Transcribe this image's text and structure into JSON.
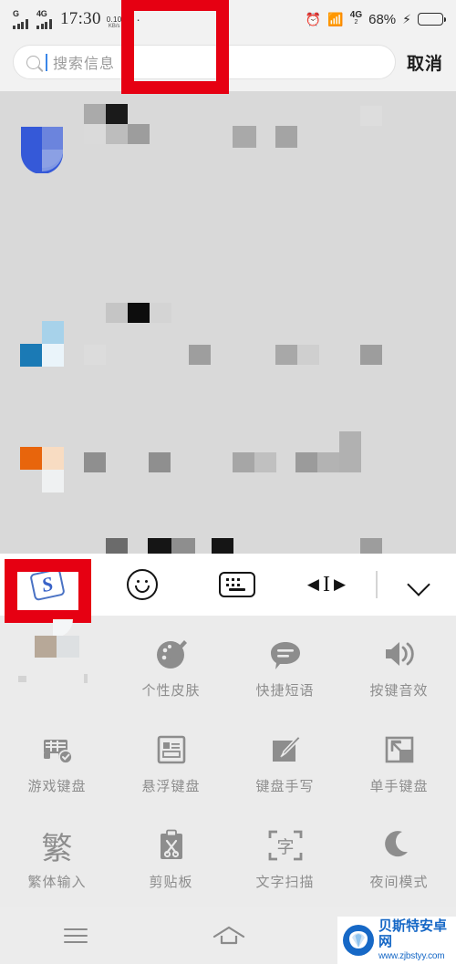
{
  "statusbar": {
    "carrier1_label": "G",
    "carrier2_label": "4G",
    "time": "17:30",
    "netspeed_value": "0.10",
    "netspeed_unit": "KB/s",
    "overflow_dots": "··",
    "alarm_icon": "alarm-clock-icon",
    "vibrate_icon": "vibrate-icon",
    "sim2_label": "4G",
    "sim2_sub": "2",
    "battery_percent": "68%",
    "charging_icon": "lightning-bolt-icon",
    "battery_fill_percent": 68
  },
  "search": {
    "placeholder": "搜索信息",
    "value": "",
    "icon": "search-icon",
    "cancel_label": "取消",
    "caret_color": "#3a86e8"
  },
  "keyboard_toolbar": {
    "items": [
      {
        "name": "sogou-logo-button",
        "label": "S",
        "icon": "sogou-logo-icon",
        "highlighted": true
      },
      {
        "name": "emoji-button",
        "label": "",
        "icon": "smiley-icon",
        "highlighted": false
      },
      {
        "name": "keyboard-layout-button",
        "label": "",
        "icon": "keyboard-icon",
        "highlighted": false
      },
      {
        "name": "cursor-move-button",
        "label": "",
        "icon": "cursor-move-icon",
        "highlighted": false
      },
      {
        "name": "collapse-keyboard-button",
        "label": "",
        "icon": "chevron-down-icon",
        "highlighted": false
      }
    ]
  },
  "panel": {
    "rows": [
      [
        {
          "label": "",
          "icon": "blurred-icon",
          "blurred": true,
          "highlighted": false
        },
        {
          "label": "个性皮肤",
          "icon": "palette-brush-icon",
          "blurred": false,
          "highlighted": true
        },
        {
          "label": "快捷短语",
          "icon": "chat-bubble-icon",
          "blurred": false,
          "highlighted": false
        },
        {
          "label": "按键音效",
          "icon": "speaker-icon",
          "blurred": false,
          "highlighted": false
        }
      ],
      [
        {
          "label": "游戏键盘",
          "icon": "gamepad-check-icon",
          "blurred": false,
          "highlighted": false
        },
        {
          "label": "悬浮键盘",
          "icon": "floating-keyboard-icon",
          "blurred": false,
          "highlighted": false
        },
        {
          "label": "键盘手写",
          "icon": "handwriting-pen-icon",
          "blurred": false,
          "highlighted": false
        },
        {
          "label": "单手键盘",
          "icon": "one-hand-keyboard-icon",
          "blurred": false,
          "highlighted": false
        }
      ],
      [
        {
          "label": "繁体输入",
          "icon": "traditional-chinese-icon",
          "glyph": "繁",
          "blurred": false,
          "highlighted": false
        },
        {
          "label": "剪贴板",
          "icon": "clipboard-scissors-icon",
          "blurred": false,
          "highlighted": false
        },
        {
          "label": "文字扫描",
          "icon": "text-scan-icon",
          "glyph": "字",
          "blurred": false,
          "highlighted": false
        },
        {
          "label": "夜间模式",
          "icon": "moon-icon",
          "blurred": false,
          "highlighted": false
        }
      ]
    ]
  },
  "navbar": {
    "recents_icon": "menu-recents-icon",
    "home_icon": "home-icon"
  },
  "watermark": {
    "site_name": "贝斯特安卓网",
    "url": "www.zjbstyy.com",
    "logo_icon": "shell-logo-icon",
    "color": "#1668c6"
  },
  "highlight": {
    "color": "#e60012",
    "count": 2
  }
}
